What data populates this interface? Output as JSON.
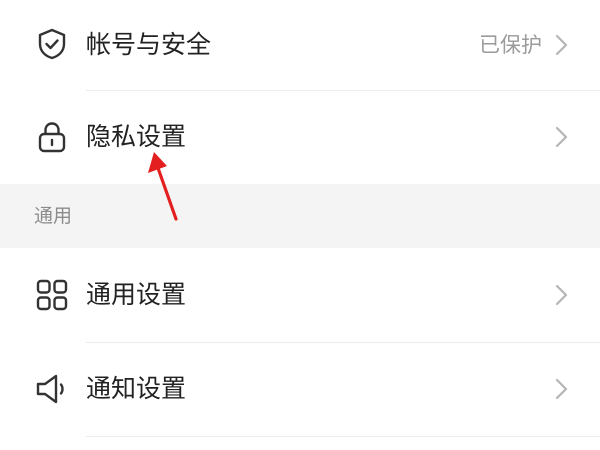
{
  "security": {
    "label": "帐号与安全",
    "value": "已保护",
    "icon": "shield-check-icon"
  },
  "privacy": {
    "label": "隐私设置",
    "icon": "lock-icon"
  },
  "section_general": {
    "title": "通用"
  },
  "general": {
    "label": "通用设置",
    "icon": "grid-icon"
  },
  "notify": {
    "label": "通知设置",
    "icon": "speaker-icon"
  },
  "colors": {
    "accent_arrow": "#e41f1f",
    "text": "#222222",
    "muted": "#9b9b9b",
    "section_bg": "#f4f4f4"
  }
}
